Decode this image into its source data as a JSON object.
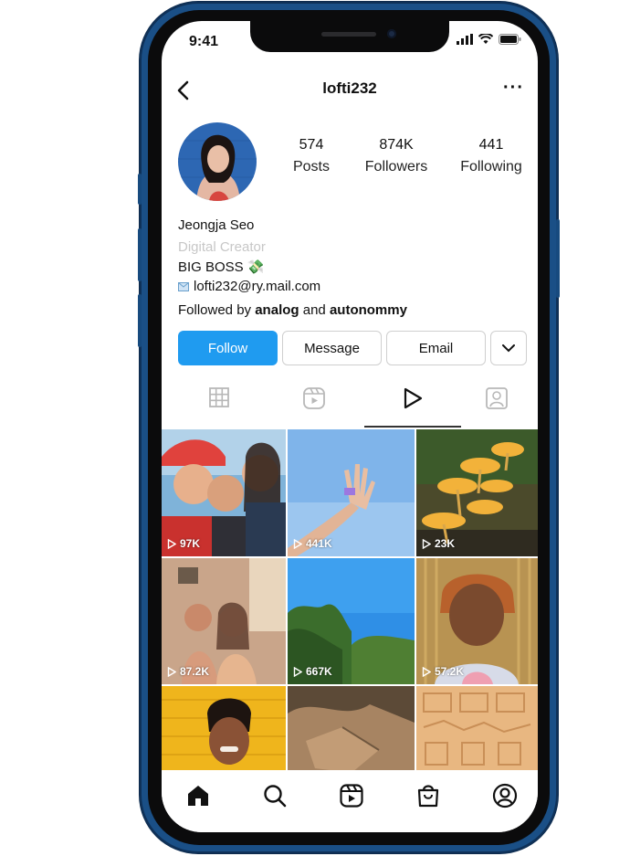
{
  "status_bar": {
    "time": "9:41"
  },
  "header": {
    "username": "lofti232",
    "more": "···"
  },
  "profile": {
    "stats": [
      {
        "value": "574",
        "label": "Posts"
      },
      {
        "value": "874K",
        "label": "Followers"
      },
      {
        "value": "441",
        "label": "Following"
      }
    ],
    "name": "Jeongja Seo",
    "category": "Digital Creator",
    "bio_line": "BIG BOSS 💸",
    "email": "lofti232@ry.mail.com",
    "followed_prefix": "Followed by ",
    "followed_user1": "analog",
    "followed_and": " and ",
    "followed_user2": "autonommy"
  },
  "actions": {
    "follow": "Follow",
    "message": "Message",
    "email": "Email"
  },
  "tabs": [
    "grid-icon",
    "reels-icon",
    "play-icon",
    "tagged-icon"
  ],
  "active_tab": 2,
  "grid_items": [
    {
      "views": "97K"
    },
    {
      "views": "441K"
    },
    {
      "views": "23K"
    },
    {
      "views": "87.2K"
    },
    {
      "views": "667K"
    },
    {
      "views": "57.2K"
    }
  ],
  "bottom_nav": [
    "home-icon",
    "search-icon",
    "reels-icon",
    "shop-icon",
    "profile-icon"
  ],
  "colors": {
    "accent": "#1f9bf0",
    "phone_frame": "#1a4f86"
  }
}
